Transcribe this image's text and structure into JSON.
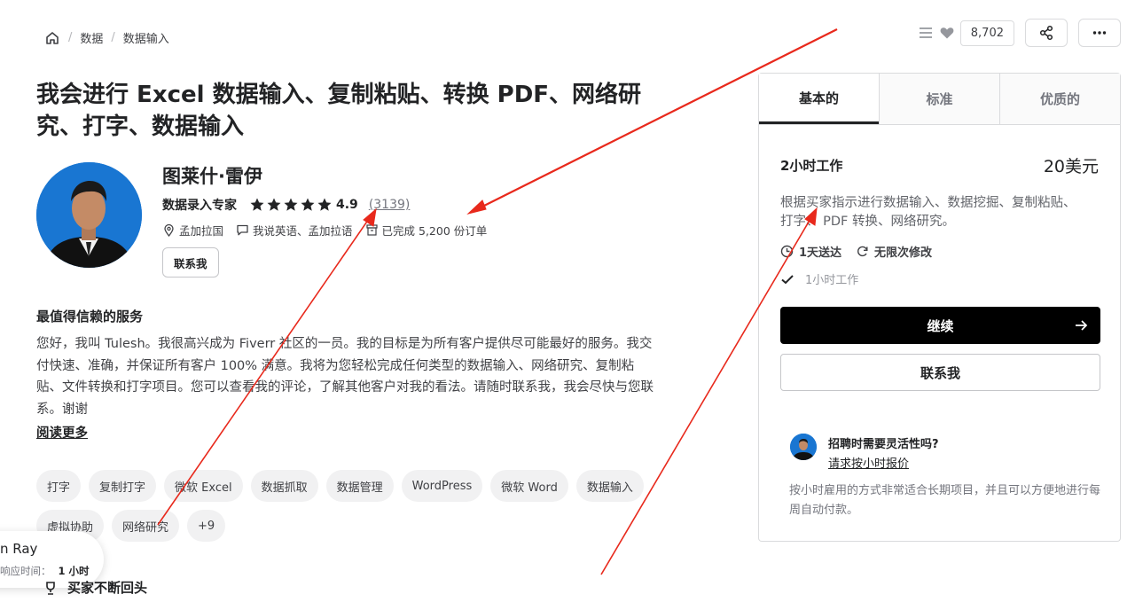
{
  "breadcrumb": {
    "items": [
      "数据",
      "数据输入"
    ]
  },
  "top_actions": {
    "save_count": "8,702"
  },
  "gig": {
    "title": "我会进行 Excel 数据输入、复制粘贴、转换 PDF、网络研究、打字、数据输入"
  },
  "seller": {
    "name": "图莱什·雷伊",
    "level": "数据录入专家",
    "rating": "4.9",
    "stars": 5,
    "reviews": "(3139)",
    "location": "孟加拉国",
    "languages": "我说英语、孟加拉语",
    "orders": "已完成 5,200 份订单",
    "contact_label": "联系我"
  },
  "about": {
    "heading": "最值得信赖的服务",
    "text": "您好，我叫 Tulesh。我很高兴成为 Fiverr 社区的一员。我的目标是为所有客户提供尽可能最好的服务。我交付快速、准确，并保证所有客户 100% 满意。我将为您轻松完成任何类型的数据输入、网络研究、复制粘贴、文件转换和打字项目。您可以查看我的评论，了解其他客户对我的看法。请随时联系我，我会尽快与您联系。谢谢",
    "read_more": "阅读更多"
  },
  "tags": [
    "打字",
    "复制打字",
    "微软 Excel",
    "数据抓取",
    "数据管理",
    "WordPress",
    "微软 Word",
    "数据输入",
    "虚拟协助",
    "网络研究",
    "+9"
  ],
  "bottom": {
    "heading": "买家不断回头"
  },
  "float_card": {
    "name": "n Ray",
    "response_label": "响应时间：",
    "response_value": "1 小时"
  },
  "packages": {
    "tabs": [
      "基本的",
      "标准",
      "优质的"
    ],
    "active_tab": 0,
    "name": "2小时工作",
    "price": "20美元",
    "description": "根据买家指示进行数据输入、数据挖掘、复制粘贴、打字、 PDF 转换、网络研究。",
    "delivery": "1天送达",
    "revisions": "无限次修改",
    "includes": [
      "1小时工作"
    ],
    "continue_label": "继续",
    "contact_label": "联系我"
  },
  "hourly": {
    "title": "招聘时需要灵活性吗?",
    "link": "请求按小时报价",
    "text": "按小时雇用的方式非常适合长期项目，并且可以方便地进行每周自动付款。"
  },
  "colors": {
    "annotation_arrow": "#e8291c",
    "avatar_bg": "#1976d2",
    "star": "#222325",
    "primary_button": "#000000"
  }
}
